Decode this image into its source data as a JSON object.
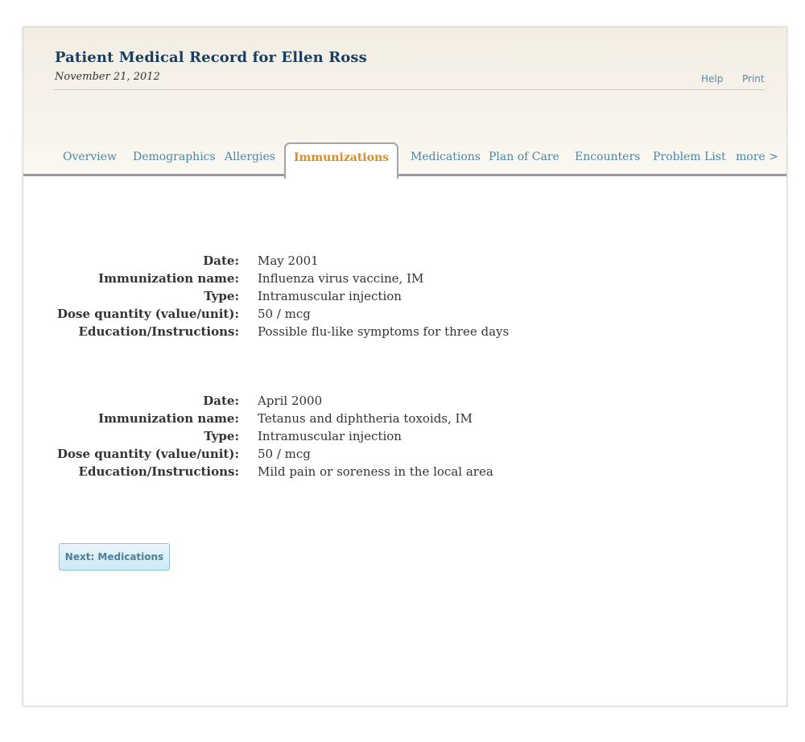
{
  "header": {
    "title": "Patient Medical Record for Ellen Ross",
    "date": "November 21, 2012",
    "help_label": "Help",
    "print_label": "Print"
  },
  "tabs": [
    {
      "label": "Overview"
    },
    {
      "label": "Demographics"
    },
    {
      "label": "Allergies"
    },
    {
      "label": "Immunizations",
      "active": true
    },
    {
      "label": "Medications"
    },
    {
      "label": "Plan of Care"
    },
    {
      "label": "Encounters"
    },
    {
      "label": "Problem List"
    },
    {
      "label": "more >"
    }
  ],
  "labels": {
    "date": "Date:",
    "name": "Immunization name:",
    "type": "Type:",
    "dose": "Dose quantity (value/unit):",
    "education": "Education/Instructions:"
  },
  "immunizations": [
    {
      "date": "May 2001",
      "name": "Influenza virus vaccine, IM",
      "type": "Intramuscular injection",
      "dose": "50 / mcg",
      "education": "Possible flu-like symptoms for three days"
    },
    {
      "date": "April 2000",
      "name": "Tetanus and diphtheria toxoids, IM",
      "type": "Intramuscular injection",
      "dose": "50 / mcg",
      "education": "Mild pain or soreness in the local area"
    }
  ],
  "next_button": {
    "label": "Next: Medications"
  },
  "colors": {
    "title": "#1c3e5e",
    "tab_link": "#4d86a6",
    "tab_active": "#e08a1e",
    "button_text": "#4d7f99"
  }
}
